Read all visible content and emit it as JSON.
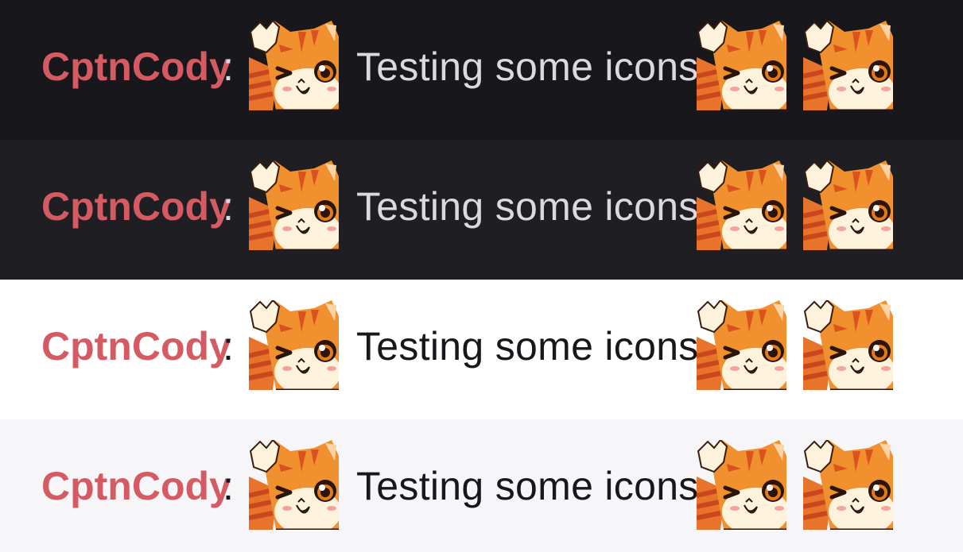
{
  "chat": {
    "messages": [
      {
        "username": "CptnCody",
        "separator": ":",
        "emote_before": "waving-cat-emote",
        "text": "Testing some icons",
        "emotes_after": [
          "waving-cat-emote",
          "waving-cat-emote"
        ],
        "theme": "dark"
      },
      {
        "username": "CptnCody",
        "separator": ":",
        "emote_before": "waving-cat-emote",
        "text": "Testing some icons",
        "emotes_after": [
          "waving-cat-emote",
          "waving-cat-emote"
        ],
        "theme": "dark"
      },
      {
        "username": "CptnCody",
        "separator": ":",
        "emote_before": "waving-cat-emote",
        "text": "Testing some icons",
        "emotes_after": [
          "waving-cat-emote",
          "waving-cat-emote"
        ],
        "theme": "light"
      },
      {
        "username": "CptnCody",
        "separator": ":",
        "emote_before": "waving-cat-emote",
        "text": "Testing some icons",
        "emotes_after": [
          "waving-cat-emote",
          "waving-cat-emote"
        ],
        "theme": "light"
      }
    ]
  },
  "colors": {
    "username": "#d45b63",
    "dark_bg_1": "#18171b",
    "dark_bg_2": "#1f1e23",
    "light_bg_1": "#ffffff",
    "light_bg_2": "#f6f6f8",
    "dark_text": "#dad9de",
    "light_text": "#18171b",
    "cat_orange": "#f0902e",
    "cat_stripe": "#d9531e",
    "cat_cream": "#fdf3dc"
  }
}
